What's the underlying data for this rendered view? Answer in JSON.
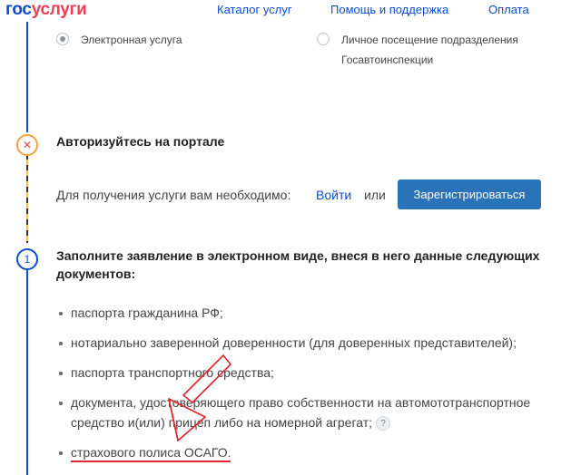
{
  "header": {
    "logo_part1": "гос",
    "logo_part2": "услуги",
    "nav": [
      "Каталог услуг",
      "Помощь и поддержка",
      "Оплата"
    ]
  },
  "method": {
    "option_electronic": "Электронная услуга",
    "option_visit_line1": "Личное посещение подразделения",
    "option_visit_line2": "Госавтоинспекции",
    "selected": "Электронная услуга"
  },
  "step_auth": {
    "marker": "✕",
    "title": "Авторизуйтесь на портале",
    "text": "Для получения услуги вам необходимо:",
    "login_link": "Войти",
    "or": "или",
    "register_button": "Зарегистрироваться"
  },
  "step_fill": {
    "marker": "1",
    "title_line1": "Заполните заявление в электронном виде, внеся в него данные следующих",
    "title_line2": "документов:",
    "documents": [
      "паспорта гражданина РФ;",
      "нотариально заверенной доверенности (для доверенных представителей);",
      "паспорта транспортного средства;",
      "документа, удостоверяющего право собственности на автомототранспортное",
      "средство и(или) прицеп либо на номерной агрегат;",
      "страхового полиса ОСАГО."
    ],
    "help_glyph": "?"
  },
  "colors": {
    "brand_blue": "#0d4cd3",
    "brand_red": "#ee3f58",
    "button_blue": "#2a73b9",
    "annotation_red": "#e0262f"
  }
}
